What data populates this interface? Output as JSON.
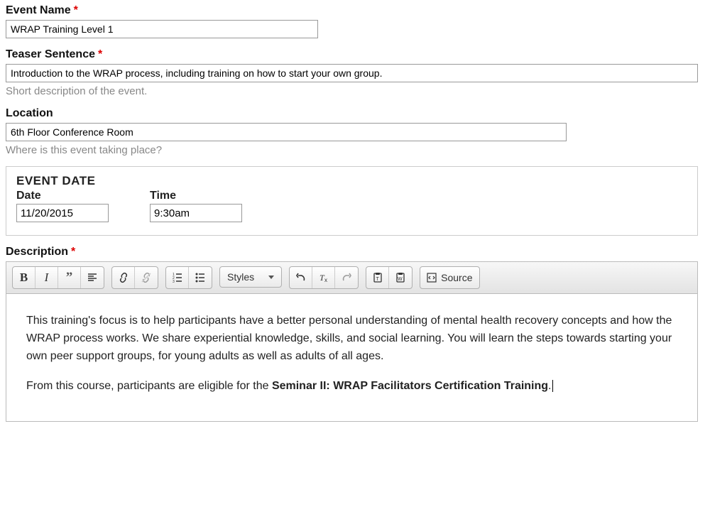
{
  "eventName": {
    "label": "Event Name",
    "value": "WRAP Training Level 1",
    "required": true
  },
  "teaser": {
    "label": "Teaser Sentence",
    "value": "Introduction to the WRAP process, including training on how to start your own group.",
    "required": true,
    "help": "Short description of the event."
  },
  "location": {
    "label": "Location",
    "value": "6th Floor Conference Room",
    "required": false,
    "help": "Where is this event taking place?"
  },
  "eventDate": {
    "title": "EVENT DATE",
    "dateLabel": "Date",
    "timeLabel": "Time",
    "date": "11/20/2015",
    "time": "9:30am"
  },
  "description": {
    "label": "Description",
    "required": true
  },
  "toolbar": {
    "stylesLabel": "Styles",
    "sourceLabel": "Source"
  },
  "editor": {
    "para1": "This training's focus is to help participants have a better personal understanding of mental health recovery concepts and how the WRAP process works. We share experiential knowledge, skills, and social learning. You will learn the steps towards starting your own peer support groups, for young adults as well as adults of all ages.",
    "para2a": "From this course, participants are eligible for the ",
    "para2b": "Seminar II: WRAP Facilitators Certification Training",
    "para2c": "."
  }
}
